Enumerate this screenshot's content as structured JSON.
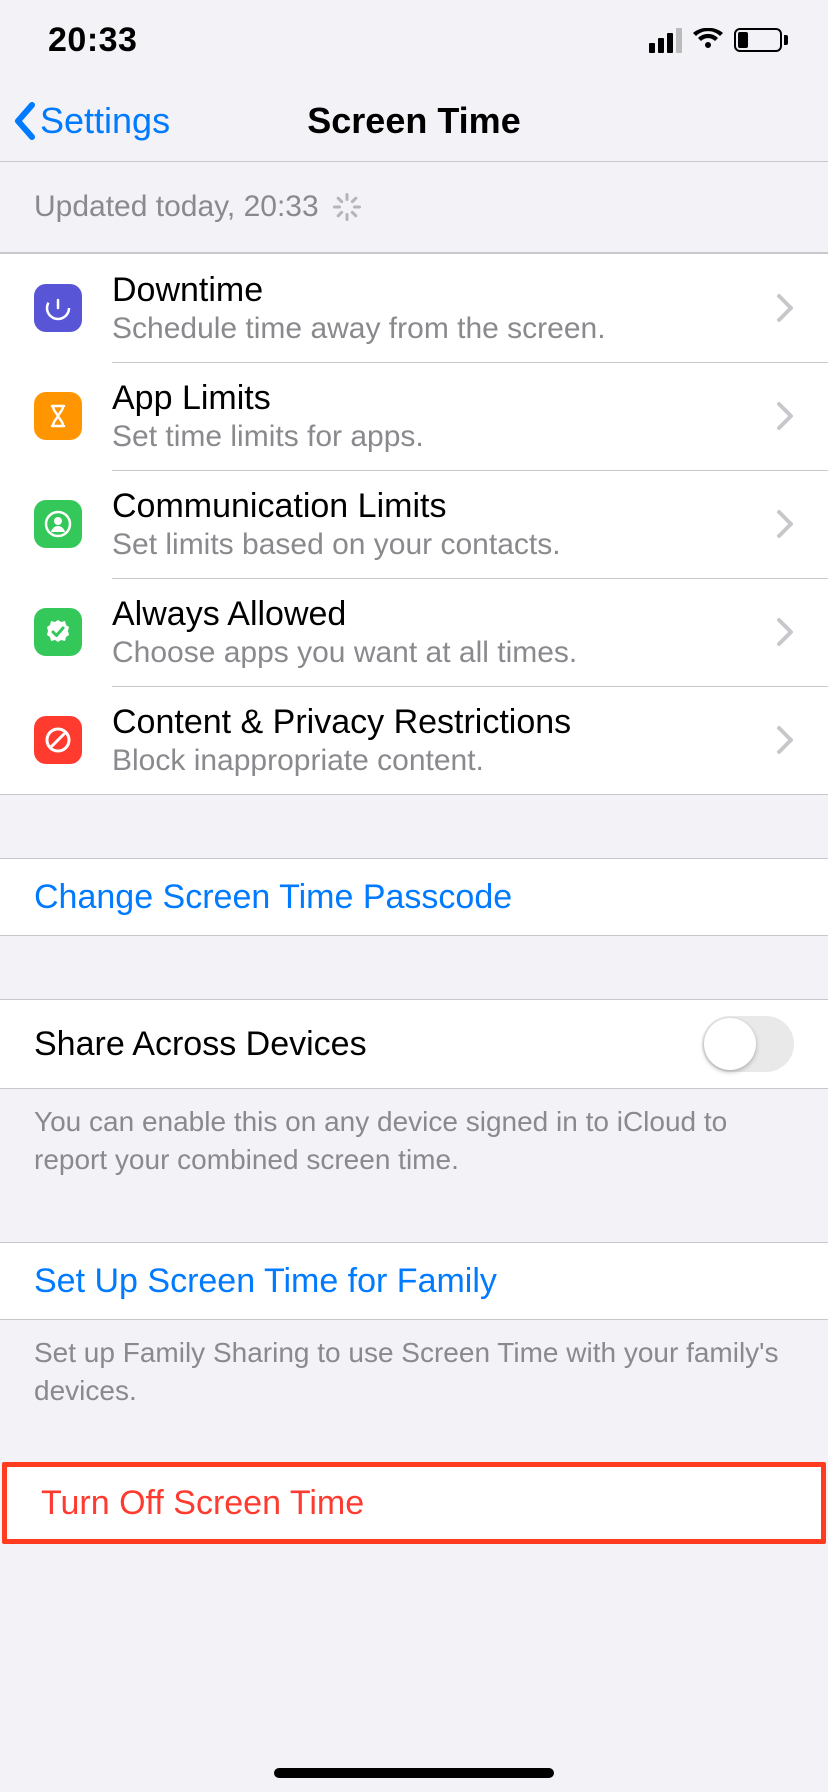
{
  "status": {
    "time": "20:33"
  },
  "nav": {
    "back": "Settings",
    "title": "Screen Time"
  },
  "update": {
    "text": "Updated today, 20:33"
  },
  "options": {
    "downtime": {
      "title": "Downtime",
      "sub": "Schedule time away from the screen."
    },
    "app_limits": {
      "title": "App Limits",
      "sub": "Set time limits for apps."
    },
    "comm_limits": {
      "title": "Communication Limits",
      "sub": "Set limits based on your contacts."
    },
    "always": {
      "title": "Always Allowed",
      "sub": "Choose apps you want at all times."
    },
    "content": {
      "title": "Content & Privacy Restrictions",
      "sub": "Block inappropriate content."
    }
  },
  "passcode": {
    "label": "Change Screen Time Passcode"
  },
  "share": {
    "label": "Share Across Devices",
    "on": false,
    "footer": "You can enable this on any device signed in to iCloud to report your combined screen time."
  },
  "family": {
    "label": "Set Up Screen Time for Family",
    "footer": "Set up Family Sharing to use Screen Time with your family's devices."
  },
  "turn_off": {
    "label": "Turn Off Screen Time"
  }
}
